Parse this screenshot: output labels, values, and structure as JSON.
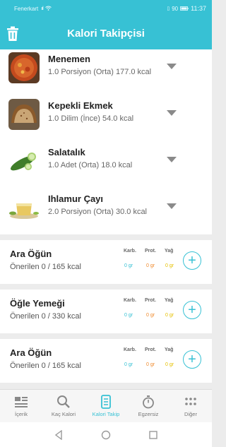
{
  "status_bar": {
    "carrier": "Fenerkart",
    "signal": "ııl",
    "battery": "90",
    "time": "11:37"
  },
  "header": {
    "title": "Kalori Takipçisi"
  },
  "foods": [
    {
      "name": "Menemen",
      "detail": "1.0 Porsiyon (Orta) 177.0 kcal",
      "icon": "menemen-thumbnail"
    },
    {
      "name": "Kepekli Ekmek",
      "detail": "1.0 Dilim (İnce) 54.0 kcal",
      "icon": "bread-thumbnail"
    },
    {
      "name": "Salatalık",
      "detail": "1.0 Adet (Orta) 18.0 kcal",
      "icon": "cucumber-thumbnail"
    },
    {
      "name": "Ihlamur Çayı",
      "detail": "2.0 Porsiyon (Orta) 30.0 kcal",
      "icon": "tea-thumbnail"
    }
  ],
  "macro_labels": {
    "carb": "Karb.",
    "prot": "Prot.",
    "fat": "Yağ"
  },
  "macro_colors": {
    "carb": "#37c1d4",
    "prot": "#f08a2c",
    "fat": "#e6c100"
  },
  "meals": [
    {
      "name": "Ara Öğün",
      "recommended": "Önerilen 0 / 165 kcal",
      "carb": "0 gr",
      "prot": "0 gr",
      "fat": "0 gr"
    },
    {
      "name": "Öğle Yemeği",
      "recommended": "Önerilen 0 / 330 kcal",
      "carb": "0 gr",
      "prot": "0 gr",
      "fat": "0 gr"
    },
    {
      "name": "Ara Öğün",
      "recommended": "Önerilen 0 / 165 kcal",
      "carb": "0 gr",
      "prot": "0 gr",
      "fat": "0 gr"
    }
  ],
  "bottom_nav": [
    {
      "label": "İçerik",
      "icon": "content-icon"
    },
    {
      "label": "Kaç Kalori",
      "icon": "search-icon"
    },
    {
      "label": "Kalori Takip",
      "icon": "tracker-icon",
      "active": true
    },
    {
      "label": "Egzersiz",
      "icon": "stopwatch-icon"
    },
    {
      "label": "Diğer",
      "icon": "more-grid-icon"
    }
  ],
  "accent_color": "#37c1d4"
}
